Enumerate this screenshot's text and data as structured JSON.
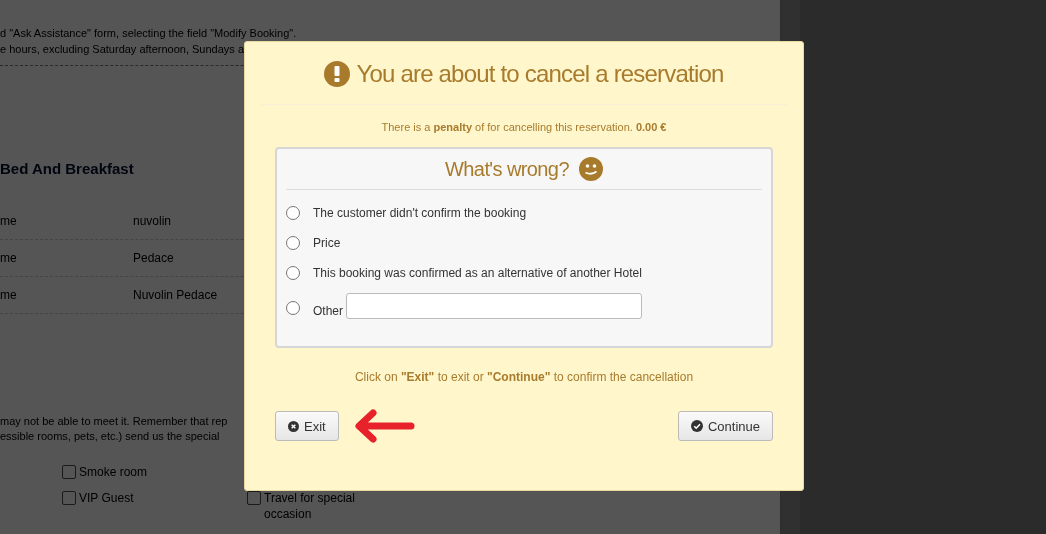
{
  "background_page": {
    "notice_lines": [
      "d \"Ask Assistance\" form, selecting the field \"Modify Booking\".",
      "e hours, excluding Saturday afternoon, Sundays a"
    ],
    "heading": "Bed And Breakfast",
    "details": [
      {
        "label": "me",
        "value": "nuvolin"
      },
      {
        "label": "me",
        "value": "Pedace"
      },
      {
        "label": "me",
        "value": "Nuvolin Pedace"
      }
    ],
    "requests_text": [
      "may not be able to meet it. Remember that rep",
      "essible rooms, pets, etc.) send us the special"
    ],
    "options": [
      {
        "label": "Smoke room",
        "checked": false
      },
      {
        "label": "VIP Guest",
        "checked": false
      },
      {
        "label": "Travel for special occasion",
        "checked": false
      }
    ]
  },
  "dialog": {
    "title": "You are about to cancel a reservation",
    "penalty_text": "There is a **penalty** of for cancelling this reservation. **0.00 €**",
    "reasons_title": "What's wrong?",
    "reasons": [
      {
        "kind": "option",
        "label": "The customer didn't confirm the booking",
        "selected": false
      },
      {
        "kind": "option",
        "label": "Price",
        "selected": false
      },
      {
        "kind": "option",
        "label": "This booking was confirmed as an alternative of another Hotel",
        "selected": false
      },
      {
        "kind": "other",
        "label": "Other",
        "selected": false
      }
    ],
    "instructions": "Click on **\"Exit\"** to exit or **\"Continue\"** to confirm the cancellation",
    "buttons": [
      {
        "kind": "exit",
        "label": "Exit"
      },
      {
        "kind": "continue",
        "label": "Continue"
      }
    ]
  }
}
